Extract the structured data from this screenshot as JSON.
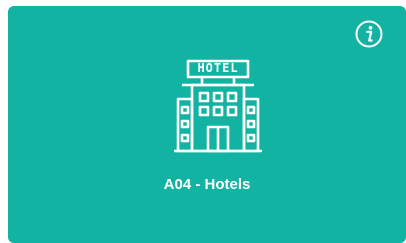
{
  "tile": {
    "title": "A04 - Hotels",
    "icon": "hotel-icon",
    "sign_text": "HOTEL",
    "info_icon": "info-icon",
    "background": "#13b3a3",
    "foreground": "#ffffff"
  }
}
